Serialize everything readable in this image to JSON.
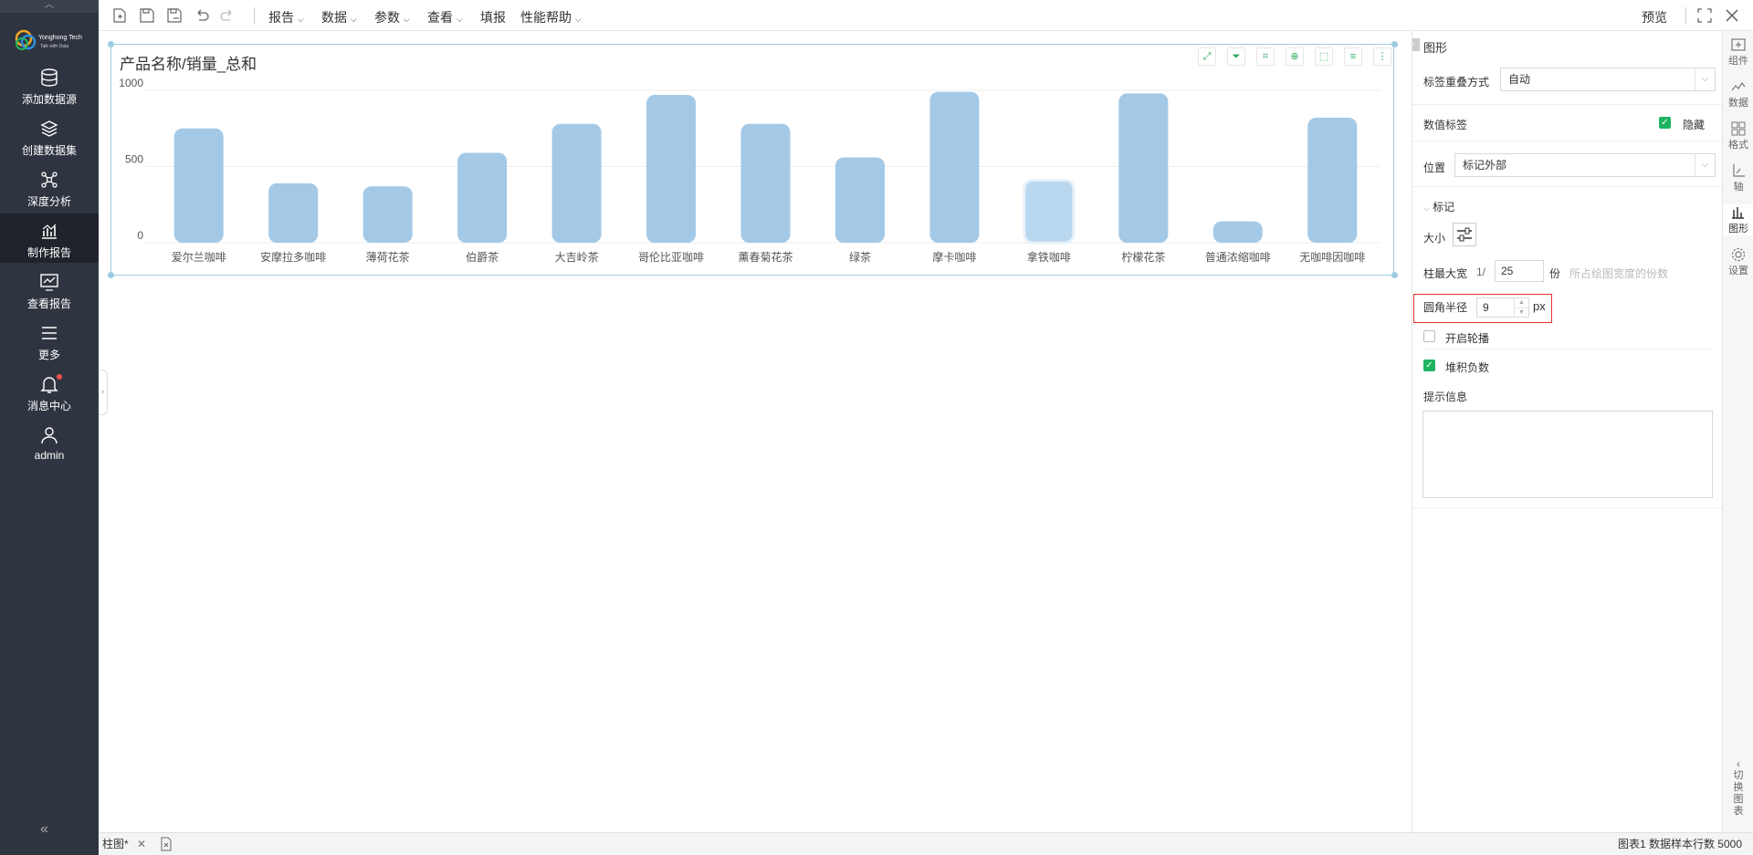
{
  "sidebar": {
    "logo_text": "Yonghong Tech",
    "logo_sub": "Talk with Data",
    "items": [
      {
        "label": "添加数据源"
      },
      {
        "label": "创建数据集"
      },
      {
        "label": "深度分析"
      },
      {
        "label": "制作报告"
      },
      {
        "label": "查看报告"
      },
      {
        "label": "更多"
      },
      {
        "label": "消息中心"
      },
      {
        "label": "admin"
      }
    ]
  },
  "toolbar": {
    "menus": [
      "报告",
      "数据",
      "参数",
      "查看",
      "填报",
      "性能帮助"
    ],
    "preview": "预览"
  },
  "chart": {
    "title": "产品名称/销量_总和"
  },
  "chart_data": {
    "type": "bar",
    "title": "产品名称/销量_总和",
    "categories": [
      "爱尔兰咖啡",
      "安摩拉多咖啡",
      "薄荷花茶",
      "伯爵茶",
      "大吉岭茶",
      "哥伦比亚咖啡",
      "薰春菊花茶",
      "绿茶",
      "摩卡咖啡",
      "拿铁咖啡",
      "柠檬花茶",
      "普通浓缩咖啡",
      "无咖啡因咖啡"
    ],
    "values": [
      750,
      390,
      370,
      590,
      780,
      970,
      780,
      560,
      990,
      410,
      980,
      140,
      820
    ],
    "highlighted_index": 9,
    "yticks": [
      "1000",
      "500",
      "0"
    ],
    "ylim": [
      0,
      1000
    ],
    "grid": true,
    "color": "#a3c9e7",
    "highlight_color": "#b9d7ee"
  },
  "props": {
    "section_title": "图形",
    "label_overlap": {
      "label": "标签重叠方式",
      "value": "自动"
    },
    "value_label": {
      "label": "数值标签",
      "hide_label": "隐藏"
    },
    "position": {
      "label": "位置",
      "value": "标记外部"
    },
    "marker_section": "标记",
    "size_label": "大小",
    "bar_max_width": {
      "label": "柱最大宽",
      "prefix": "1/",
      "value": "25",
      "unit": "份",
      "hint": "所占绘图宽度的份数"
    },
    "corner_radius": {
      "label": "圆角半径",
      "value": "9",
      "unit": "px"
    },
    "carousel": "开启轮播",
    "stack_negative": "堆积负数",
    "tooltip": "提示信息"
  },
  "rail": {
    "items": [
      "组件",
      "数据",
      "格式",
      "轴",
      "图形",
      "设置"
    ],
    "switch_chart": "切换图表"
  },
  "status": {
    "tab": "柱图*",
    "right_text": "图表1   数据样本行数 5000"
  }
}
